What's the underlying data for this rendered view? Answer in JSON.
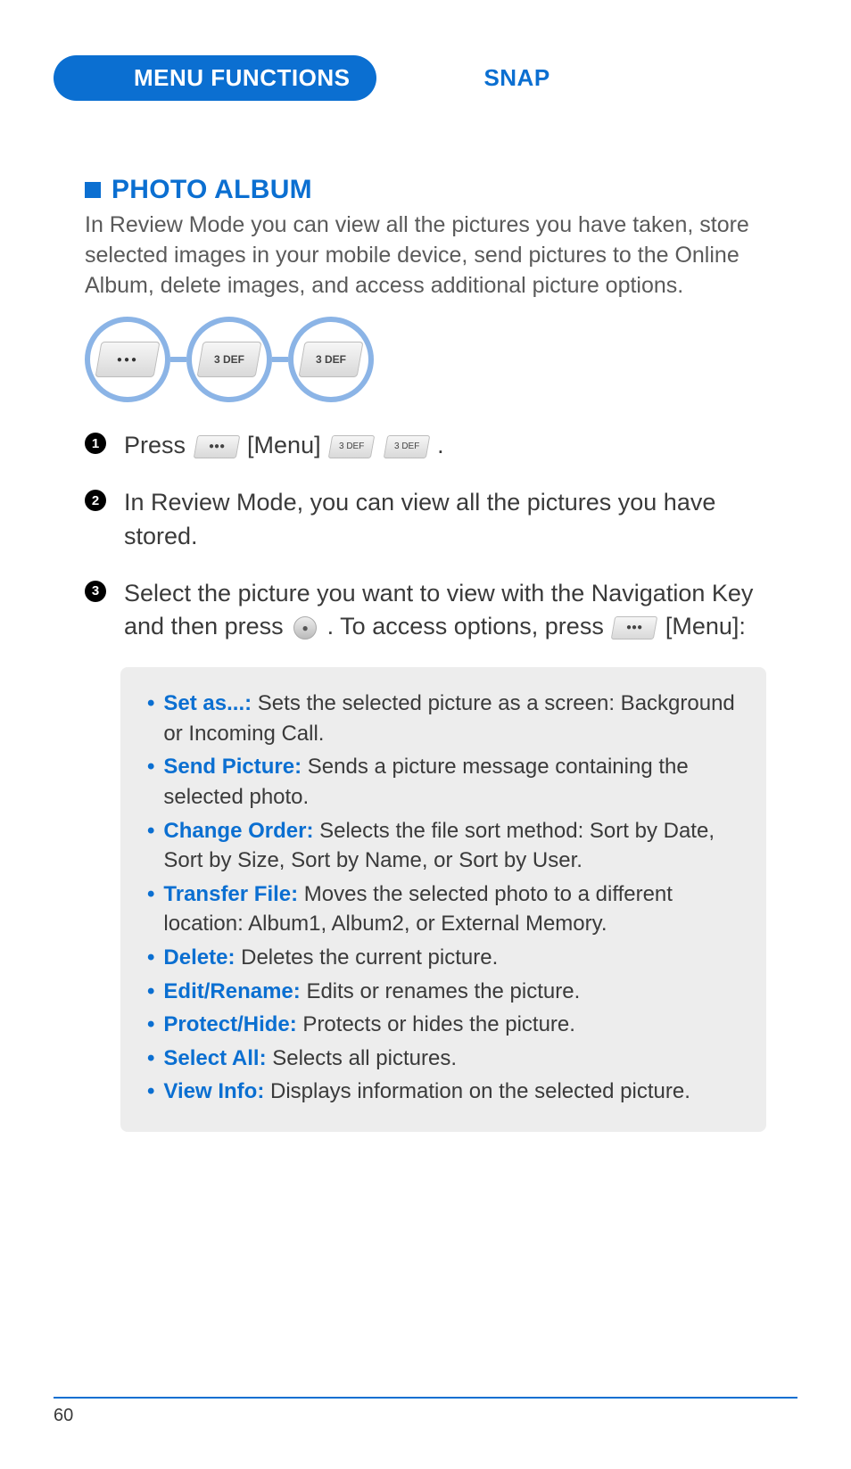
{
  "header": {
    "tab_left": "MENU FUNCTIONS",
    "tab_right": "SNAP"
  },
  "section": {
    "title": "PHOTO ALBUM",
    "intro": "In Review Mode you can view all the pictures you have taken, store selected images in your mobile device, send pictures to the Online Album, delete images, and access additional picture options."
  },
  "key_sequence": {
    "keys": [
      "menu-dots",
      "3-DEF",
      "3-DEF"
    ]
  },
  "steps": {
    "s1": {
      "prefix": "Press ",
      "menu_label": "[Menu]",
      "key_a": "3 DEF",
      "key_b": "3 DEF",
      "suffix": "."
    },
    "s2": "In Review Mode, you can view all the pictures you have stored.",
    "s3": {
      "l1": "Select the picture you want to view with the Navigation Key and then press",
      "l2": ". To access options, press",
      "menu_label": "[Menu]:"
    }
  },
  "options": [
    {
      "label": "Set as...:",
      "desc": " Sets the selected picture as a screen: Background or Incoming Call."
    },
    {
      "label": "Send Picture:",
      "desc": " Sends a picture message containing the selected photo."
    },
    {
      "label": "Change Order:",
      "desc": " Selects the file sort method: Sort by Date, Sort by Size, Sort by Name, or Sort by User."
    },
    {
      "label": "Transfer File:",
      "desc": " Moves the selected photo to a different location: Album1, Album2, or External Memory."
    },
    {
      "label": "Delete:",
      "desc": " Deletes the current picture."
    },
    {
      "label": "Edit/Rename:",
      "desc": " Edits or renames the picture."
    },
    {
      "label": "Protect/Hide:",
      "desc": " Protects or hides the picture."
    },
    {
      "label": "Select All:",
      "desc": " Selects all pictures."
    },
    {
      "label": "View Info:",
      "desc": " Displays information on the selected picture."
    }
  ],
  "footer": {
    "page": "60"
  }
}
